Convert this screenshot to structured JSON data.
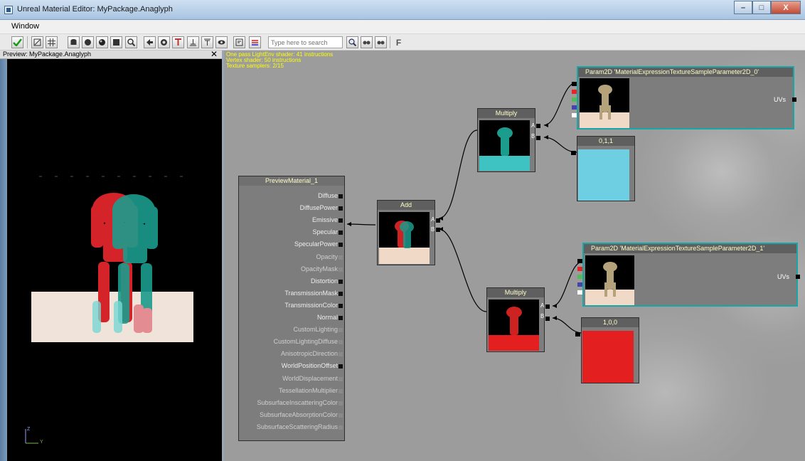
{
  "window": {
    "title": "Unreal Material Editor: MyPackage.Anaglyph",
    "minimize": "–",
    "maximize": "□",
    "close": "X"
  },
  "menu": {
    "window_label": "Window"
  },
  "toolbar": {
    "search_placeholder": "Type here to search",
    "last_label": "F"
  },
  "preview": {
    "title": "Preview: MyPackage.Anaglyph",
    "close": "✕",
    "axis_z": "Z",
    "axis_y": "Y"
  },
  "stats": {
    "line1": "One pass LightEnv shader: 41 instructions",
    "line2": "Vertex shader: 50 instructions",
    "line3": "Texture samplers: 2/15"
  },
  "nodes": {
    "material": {
      "title": "PreviewMaterial_1",
      "inputs": [
        {
          "label": "Diffuse",
          "active": true
        },
        {
          "label": "DiffusePower",
          "active": true
        },
        {
          "label": "Emissive",
          "active": true
        },
        {
          "label": "Specular",
          "active": true
        },
        {
          "label": "SpecularPower",
          "active": true
        },
        {
          "label": "Opacity",
          "active": false
        },
        {
          "label": "OpacityMask",
          "active": false
        },
        {
          "label": "Distortion",
          "active": true
        },
        {
          "label": "TransmissionMask",
          "active": true
        },
        {
          "label": "TransmissionColor",
          "active": true
        },
        {
          "label": "Normal",
          "active": true
        },
        {
          "label": "CustomLighting",
          "active": false
        },
        {
          "label": "CustomLightingDiffuse",
          "active": false
        },
        {
          "label": "AnisotropicDirection",
          "active": false
        },
        {
          "label": "WorldPositionOffset",
          "active": true
        },
        {
          "label": "WorldDisplacement",
          "active": false
        },
        {
          "label": "TessellationMultiplier",
          "active": false
        },
        {
          "label": "SubsurfaceInscatteringColor",
          "active": false
        },
        {
          "label": "SubsurfaceAbsorptionColor",
          "active": false
        },
        {
          "label": "SubsurfaceScatteringRadius",
          "active": false
        }
      ]
    },
    "add": {
      "title": "Add",
      "pin_a": "A",
      "pin_b": "B"
    },
    "multiply1": {
      "title": "Multiply",
      "pin_a": "A",
      "pin_b": "B"
    },
    "multiply2": {
      "title": "Multiply",
      "pin_a": "A",
      "pin_b": "B"
    },
    "param1": {
      "title": "Param2D 'MaterialExpressionTextureSampleParameter2D_0'",
      "uvs": "UVs"
    },
    "param2": {
      "title": "Param2D 'MaterialExpressionTextureSampleParameter2D_1'",
      "uvs": "UVs"
    },
    "const1": {
      "title": "0,1,1",
      "color": "#6ecfe2"
    },
    "const2": {
      "title": "1,0,0",
      "color": "#e31f1f"
    }
  },
  "colors": {
    "cyan": "#3ec2c2",
    "red": "#e31f1f",
    "floor": "#f0d9c6",
    "selection": "#19a6a6"
  }
}
